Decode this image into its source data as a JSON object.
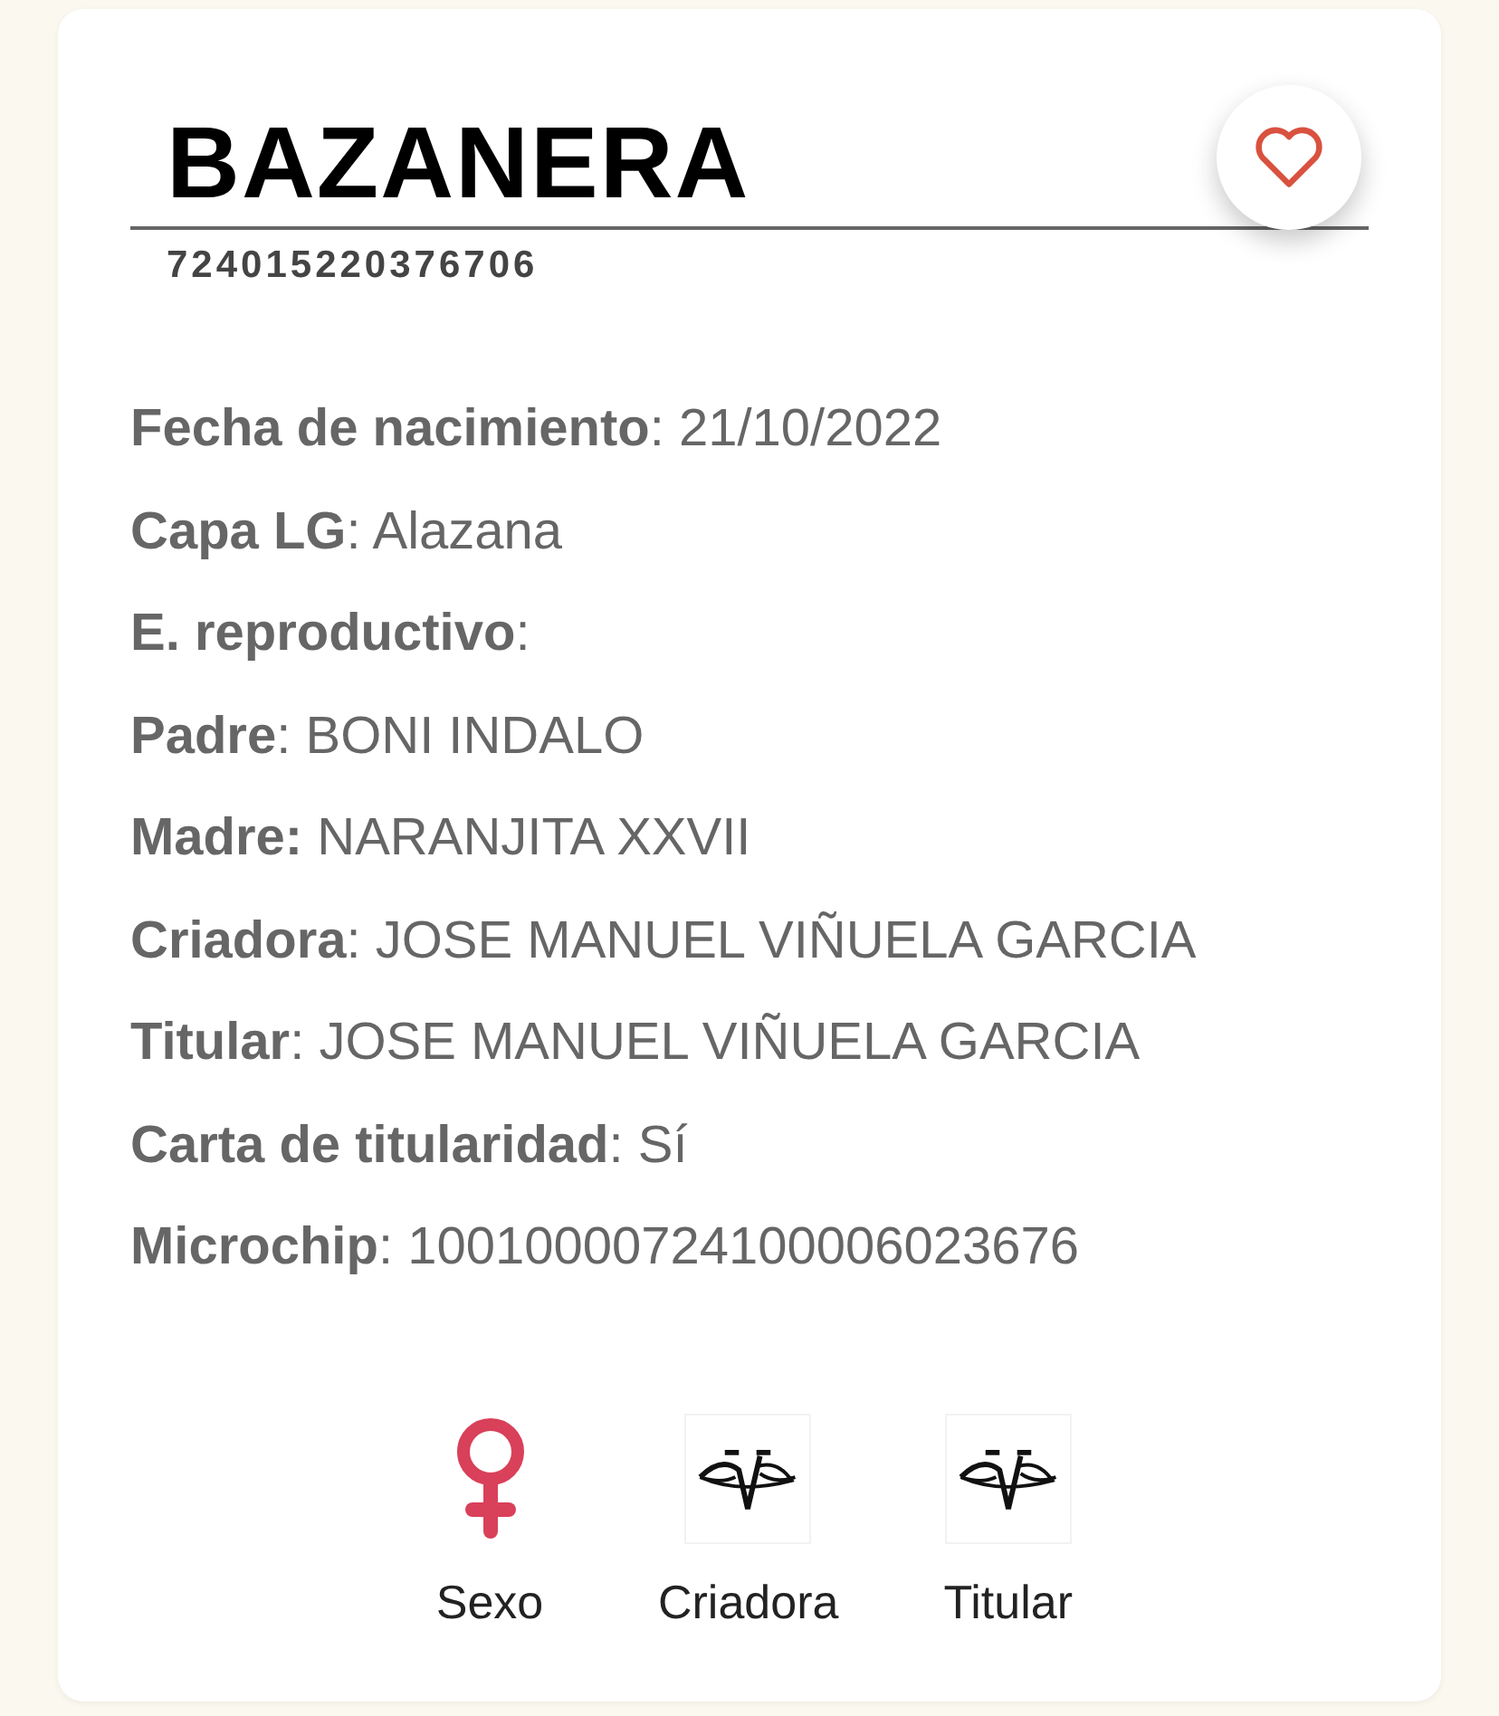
{
  "card": {
    "name": "BAZANERA",
    "code": "724015220376706",
    "favorite": {
      "selected": false
    },
    "details": [
      "**Fecha de nacimiento**: 21/10/2022",
      "**Capa LG**: Alazana",
      "**E. reproductivo**:",
      "**Padre**: BONI INDALO",
      "**Madre:** NARANJITA XXVII",
      "**Criadora**: JOSE MANUEL VIÑUELA GARCIA",
      "**Titular**: JOSE MANUEL VIÑUELA GARCIA",
      "**Carta de titularidad**: Sí",
      "**Microchip**: 10010000724100006023676"
    ],
    "badges": [
      {
        "kind": "female",
        "label": "Sexo"
      },
      {
        "kind": "logo",
        "label": "Criadora"
      },
      {
        "kind": "logo",
        "label": "Titular"
      }
    ]
  }
}
